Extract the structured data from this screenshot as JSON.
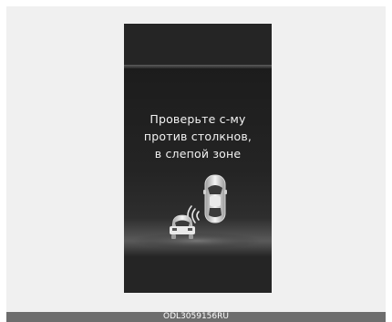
{
  "warning": {
    "line1": "Проверьте с-му",
    "line2": "против столкнов,",
    "line3": "в слепой зоне"
  },
  "figure_code": "ODL3059156RU",
  "icons": {
    "host_car": "car-top-view-icon",
    "rear_car": "car-front-view-icon",
    "signal": "radar-wave-icon"
  },
  "colors": {
    "background": "#f0f0f0",
    "display": "#252525",
    "text": "#f2f2f2",
    "footer": "#6d6d6d"
  }
}
